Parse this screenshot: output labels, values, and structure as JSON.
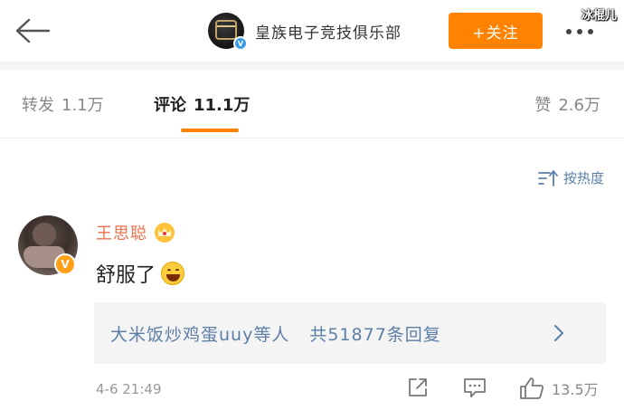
{
  "header": {
    "account_name": "皇族电子竞技俱乐部",
    "follow_label": "+关注",
    "watermark": "冰棍儿"
  },
  "tabs": [
    {
      "label": "转发",
      "count": "1.1万"
    },
    {
      "label": "评论",
      "count": "11.1万",
      "active": true
    },
    {
      "label": "赞",
      "count": "2.6万"
    }
  ],
  "sort_label": "按热度",
  "comment": {
    "user": "王思聪",
    "text": "舒服了",
    "replies_users": "大米饭炒鸡蛋uuy等人",
    "replies_total": "共51877条回复",
    "time": "4-6 21:49",
    "likes": "13.5万"
  },
  "colors": {
    "accent": "#ff8200",
    "username": "#eb7350",
    "link": "#5d7ea6",
    "verified_blue": "#3a9be8",
    "verified_gold": "#ff9f1a"
  },
  "icons": [
    "back-arrow-icon",
    "more-icon",
    "sort-icon",
    "crown-icon",
    "laugh-emoji-icon",
    "chevron-right-icon",
    "share-icon",
    "reply-icon",
    "thumbs-up-icon"
  ]
}
